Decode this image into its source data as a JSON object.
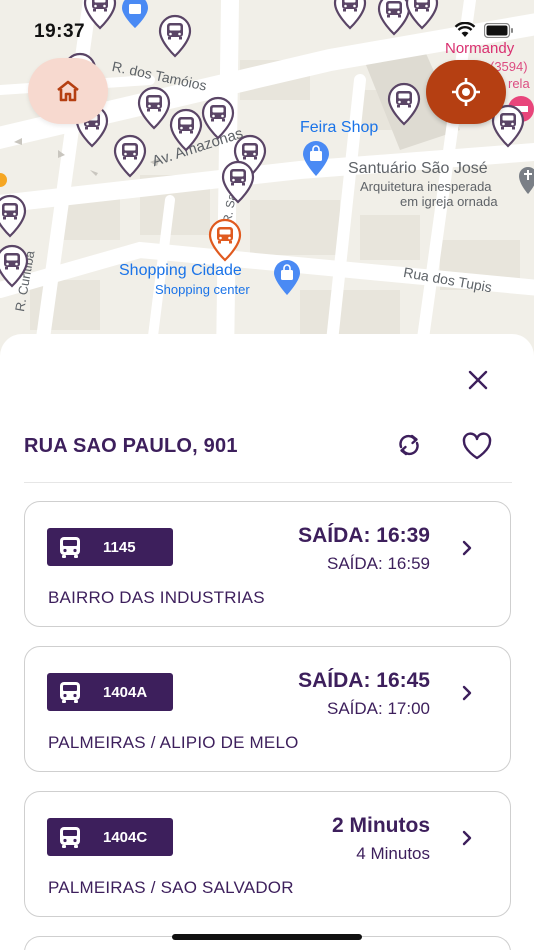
{
  "status_bar": {
    "time": "19:37"
  },
  "map": {
    "streets": [
      "R. dos Tamóios",
      "Av. Amazonas",
      "R. Sa",
      "Rua dos Tupis",
      "R. Curitiba"
    ],
    "pois": {
      "feira_shop": "Feira Shop",
      "santuario": {
        "title": "Santuário São José",
        "line1": "Arquitetura inesperada",
        "line2": "em igreja ornada"
      },
      "shopping_cidade": {
        "title": "Shopping Cidade",
        "subtitle": "Shopping center"
      },
      "normandy": {
        "title": "Normandy",
        "subtitle": "(3594)",
        "extra": "rela"
      }
    },
    "colors": {
      "bus_pin_default": "#5a4566",
      "bus_pin_selected": "#e05a1f",
      "home_button": "#f7d9cf",
      "locate_button": "#b53f12"
    }
  },
  "stop": {
    "name": "RUA SAO PAULO, 901"
  },
  "departures": [
    {
      "route": "1145",
      "primary": "SAÍDA: 16:39",
      "secondary": "SAÍDA: 16:59",
      "destination": "BAIRRO DAS INDUSTRIAS"
    },
    {
      "route": "1404A",
      "primary": "SAÍDA: 16:45",
      "secondary": "SAÍDA: 17:00",
      "destination": "PALMEIRAS / ALIPIO DE MELO"
    },
    {
      "route": "1404C",
      "primary": "2 Minutos",
      "secondary": "4 Minutos",
      "destination": "PALMEIRAS / SAO SALVADOR"
    }
  ],
  "icons": {
    "home": "home-icon",
    "locate": "crosshair-icon",
    "close": "close-icon",
    "refresh": "refresh-icon",
    "favorite": "heart-icon",
    "bus": "bus-icon",
    "chevron": "chevron-right-icon"
  },
  "theme": {
    "primary": "#3d1f5c",
    "border": "#cfcfcf"
  }
}
